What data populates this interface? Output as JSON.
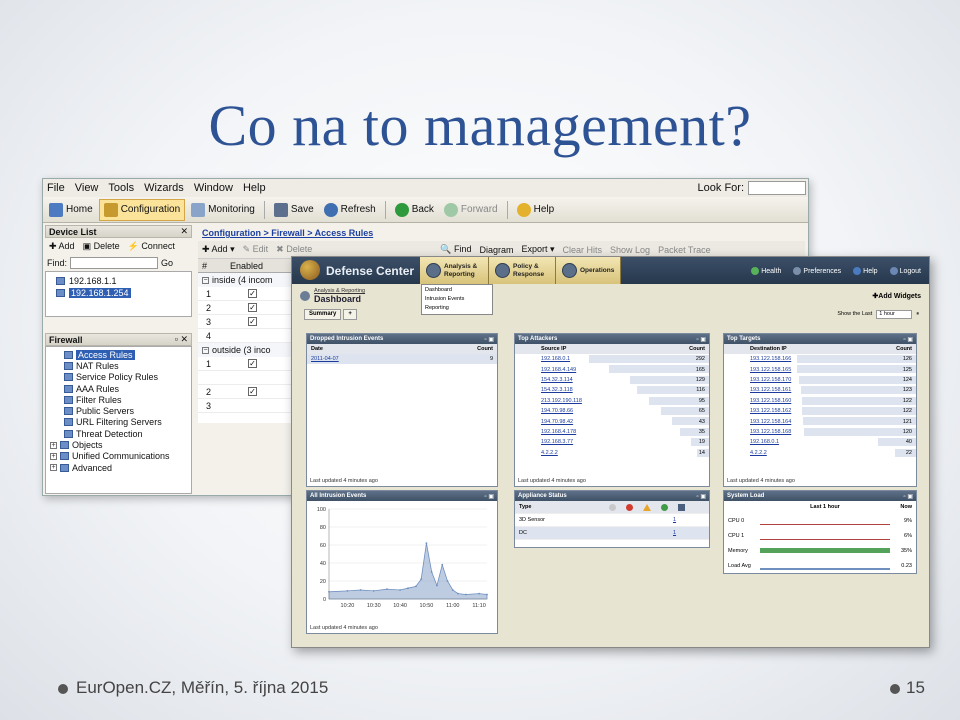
{
  "slide": {
    "title": "Co na to management?",
    "footer": "EurOpen.CZ, Měřín, 5. října 2015",
    "page_number": "15"
  },
  "asdm": {
    "menu": [
      "File",
      "View",
      "Tools",
      "Wizards",
      "Window",
      "Help"
    ],
    "look_for_label": "Look For:",
    "toolbar": {
      "home": "Home",
      "configuration": "Configuration",
      "monitoring": "Monitoring",
      "save": "Save",
      "refresh": "Refresh",
      "back": "Back",
      "forward": "Forward",
      "help": "Help"
    },
    "device_list": {
      "title": "Device List",
      "add": "Add",
      "delete": "Delete",
      "connect": "Connect",
      "find_label": "Find:",
      "go": "Go",
      "devices": [
        "192.168.1.1",
        "192.168.1.254"
      ]
    },
    "firewall": {
      "title": "Firewall",
      "items": [
        "Access Rules",
        "NAT Rules",
        "Service Policy Rules",
        "AAA Rules",
        "Filter Rules",
        "Public Servers",
        "URL Filtering Servers",
        "Threat Detection",
        "Objects",
        "Unified Communications",
        "Advanced"
      ]
    },
    "breadcrumb": "Configuration > Firewall > Access Rules",
    "actions": {
      "add": "Add",
      "edit": "Edit",
      "delete": "Delete",
      "find": "Find",
      "diagram": "Diagram",
      "export": "Export",
      "clear_hits": "Clear Hits",
      "show_log": "Show Log",
      "packet_trace": "Packet Trace"
    },
    "grid": {
      "headers": [
        "#",
        "Enabled"
      ],
      "group1": "inside (4 incom",
      "group1_rows": [
        "1",
        "2",
        "3",
        "4"
      ],
      "group2": "outside (3 inco",
      "group2_rows": [
        "1",
        "",
        "2",
        "3"
      ]
    }
  },
  "dc": {
    "brand": "Defense Center",
    "nav": [
      "Analysis & Reporting",
      "Policy & Response",
      "Operations"
    ],
    "right": [
      "Health",
      "Preferences",
      "Help",
      "Logout"
    ],
    "dropdown": [
      "Dashboard",
      "Intrusion Events",
      "Reporting"
    ],
    "crumb": "Analysis & Reporting",
    "page_title": "Dashboard",
    "add_widgets": "Add Widgets",
    "tab": "Summary",
    "show_the_last": "Show the Last",
    "show_value": "1 hour",
    "widgets": {
      "dropped": {
        "title": "Dropped Intrusion Events",
        "cols": [
          "Date",
          "Count"
        ],
        "rows": [
          {
            "date": "2011-04-07",
            "count": "9"
          }
        ],
        "footer": "Last updated 4 minutes ago"
      },
      "attackers": {
        "title": "Top Attackers",
        "cols": [
          "Source IP",
          "Count"
        ],
        "rows": [
          {
            "ip": "192.168.0.1",
            "count": "292",
            "frac": 1.0
          },
          {
            "ip": "192.168.4.149",
            "count": "165",
            "frac": 0.83
          },
          {
            "ip": "154.32.3.114",
            "count": "129",
            "frac": 0.66
          },
          {
            "ip": "154.32.3.118",
            "count": "116",
            "frac": 0.6
          },
          {
            "ip": "213.192.190.118",
            "count": "95",
            "frac": 0.5
          },
          {
            "ip": "194.70.98.66",
            "count": "65",
            "frac": 0.4
          },
          {
            "ip": "194.70.98.42",
            "count": "43",
            "frac": 0.31
          },
          {
            "ip": "192.168.4.178",
            "count": "35",
            "frac": 0.24
          },
          {
            "ip": "192.168.3.77",
            "count": "19",
            "frac": 0.15
          },
          {
            "ip": "4.2.2.2",
            "count": "14",
            "frac": 0.1
          }
        ],
        "footer": "Last updated 4 minutes ago"
      },
      "targets": {
        "title": "Top Targets",
        "cols": [
          "Destination IP",
          "Count"
        ],
        "rows": [
          {
            "ip": "193.122.158.166",
            "count": "126",
            "frac": 1.0
          },
          {
            "ip": "193.122.158.165",
            "count": "125",
            "frac": 1.0
          },
          {
            "ip": "193.122.158.170",
            "count": "124",
            "frac": 0.98
          },
          {
            "ip": "193.122.158.161",
            "count": "123",
            "frac": 0.97
          },
          {
            "ip": "193.122.158.160",
            "count": "122",
            "frac": 0.96
          },
          {
            "ip": "193.122.158.162",
            "count": "122",
            "frac": 0.96
          },
          {
            "ip": "193.122.158.164",
            "count": "121",
            "frac": 0.95
          },
          {
            "ip": "193.122.158.168",
            "count": "120",
            "frac": 0.94
          },
          {
            "ip": "192.168.0.1",
            "count": "40",
            "frac": 0.32
          },
          {
            "ip": "4.2.2.2",
            "count": "22",
            "frac": 0.18
          }
        ],
        "footer": "Last updated 4 minutes ago"
      },
      "all_events": {
        "title": "All Intrusion Events",
        "footer": "Last updated 4 minutes ago"
      },
      "appliance": {
        "title": "Appliance Status",
        "col": "Type",
        "rows": [
          {
            "type": "3D Sensor",
            "count": "1"
          },
          {
            "type": "DC",
            "count": "1"
          }
        ]
      },
      "sysload": {
        "title": "System Load",
        "col_mid": "Last 1 hour",
        "col_right": "Now",
        "rows": [
          {
            "label": "CPU 0",
            "value": "9%"
          },
          {
            "label": "CPU 1",
            "value": "6%"
          },
          {
            "label": "Memory",
            "value": "35%"
          },
          {
            "label": "Load Avg",
            "value": "0.23"
          }
        ]
      }
    }
  },
  "chart_data": {
    "type": "area",
    "title": "All Intrusion Events",
    "x_ticks": [
      "10:20",
      "10:30",
      "10:40",
      "10:50",
      "11:00",
      "11:10"
    ],
    "y_ticks": [
      0,
      20,
      40,
      60,
      80,
      100
    ],
    "ylim": [
      0,
      100
    ],
    "x": [
      "10:13",
      "10:20",
      "10:25",
      "10:30",
      "10:35",
      "10:40",
      "10:43",
      "10:46",
      "10:48",
      "10:50",
      "10:52",
      "10:54",
      "10:56",
      "10:58",
      "11:00",
      "11:02",
      "11:05",
      "11:10",
      "11:13"
    ],
    "values": [
      8,
      9,
      10,
      9,
      11,
      10,
      12,
      14,
      22,
      62,
      30,
      15,
      38,
      20,
      10,
      6,
      5,
      6,
      5
    ],
    "color": "#6f8fbf"
  }
}
